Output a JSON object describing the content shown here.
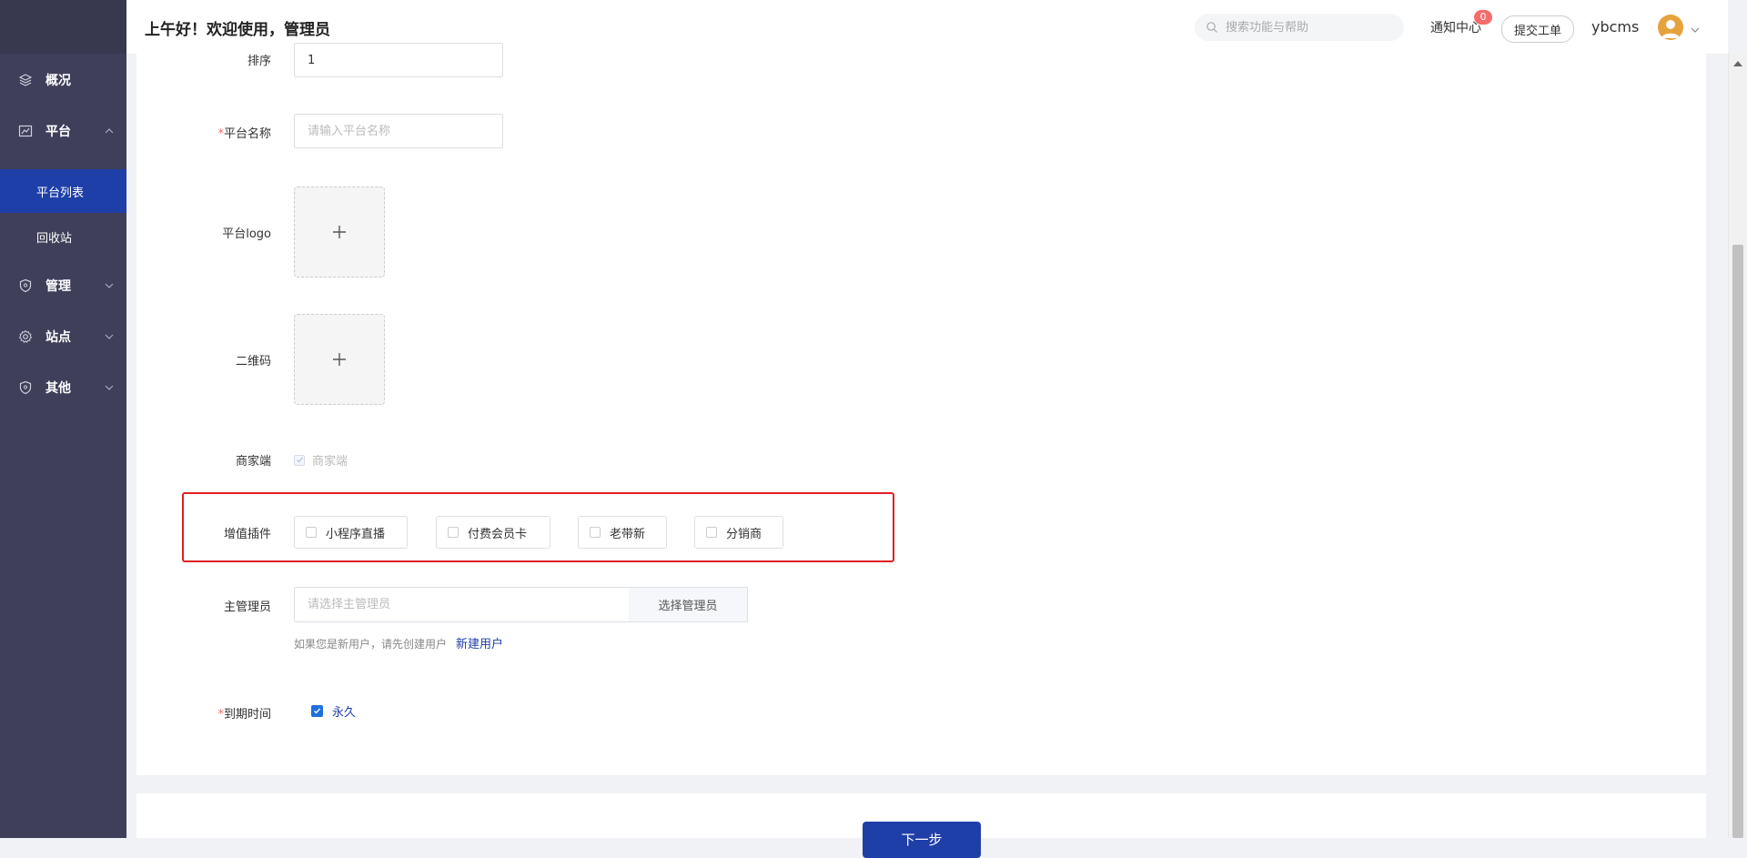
{
  "sidebar": {
    "items": [
      {
        "label": "概况",
        "icon": "layers-icon"
      },
      {
        "label": "平台",
        "icon": "chart-icon"
      },
      {
        "label": "管理",
        "icon": "shield-icon"
      },
      {
        "label": "站点",
        "icon": "gear-icon"
      },
      {
        "label": "其他",
        "icon": "shield-icon"
      }
    ],
    "subitems": [
      {
        "label": "平台列表",
        "active": true
      },
      {
        "label": "回收站",
        "active": false
      }
    ]
  },
  "header": {
    "greeting": "上午好！欢迎使用，管理员",
    "search_placeholder": "搜索功能与帮助",
    "notify_label": "通知中心",
    "notify_count": "0",
    "ticket_label": "提交工单",
    "username": "ybcms"
  },
  "form": {
    "sort_label": "排序",
    "sort_value": "1",
    "name_required": "*",
    "name_label": "平台名称",
    "name_placeholder": "请输入平台名称",
    "logo_label": "平台logo",
    "qrcode_label": "二维码",
    "merchant_label": "商家端",
    "merchant_option": "商家端",
    "plugins_label": "增值插件",
    "plugins": [
      "小程序直播",
      "付费会员卡",
      "老带新",
      "分销商"
    ],
    "admin_label": "主管理员",
    "admin_placeholder": "请选择主管理员",
    "admin_select_label": "选择管理员",
    "hint_text": "如果您是新用户，请先创建用户",
    "hint_link": "新建用户",
    "expire_required": "*",
    "expire_label": "到期时间",
    "expire_option": "永久",
    "next_label": "下一步"
  },
  "colors": {
    "sidebar_bg": "#3f3f5a",
    "active_item": "#1f3fa8",
    "primary": "#1f3fa8",
    "badge": "#f56c6c",
    "highlight": "#e02020"
  }
}
